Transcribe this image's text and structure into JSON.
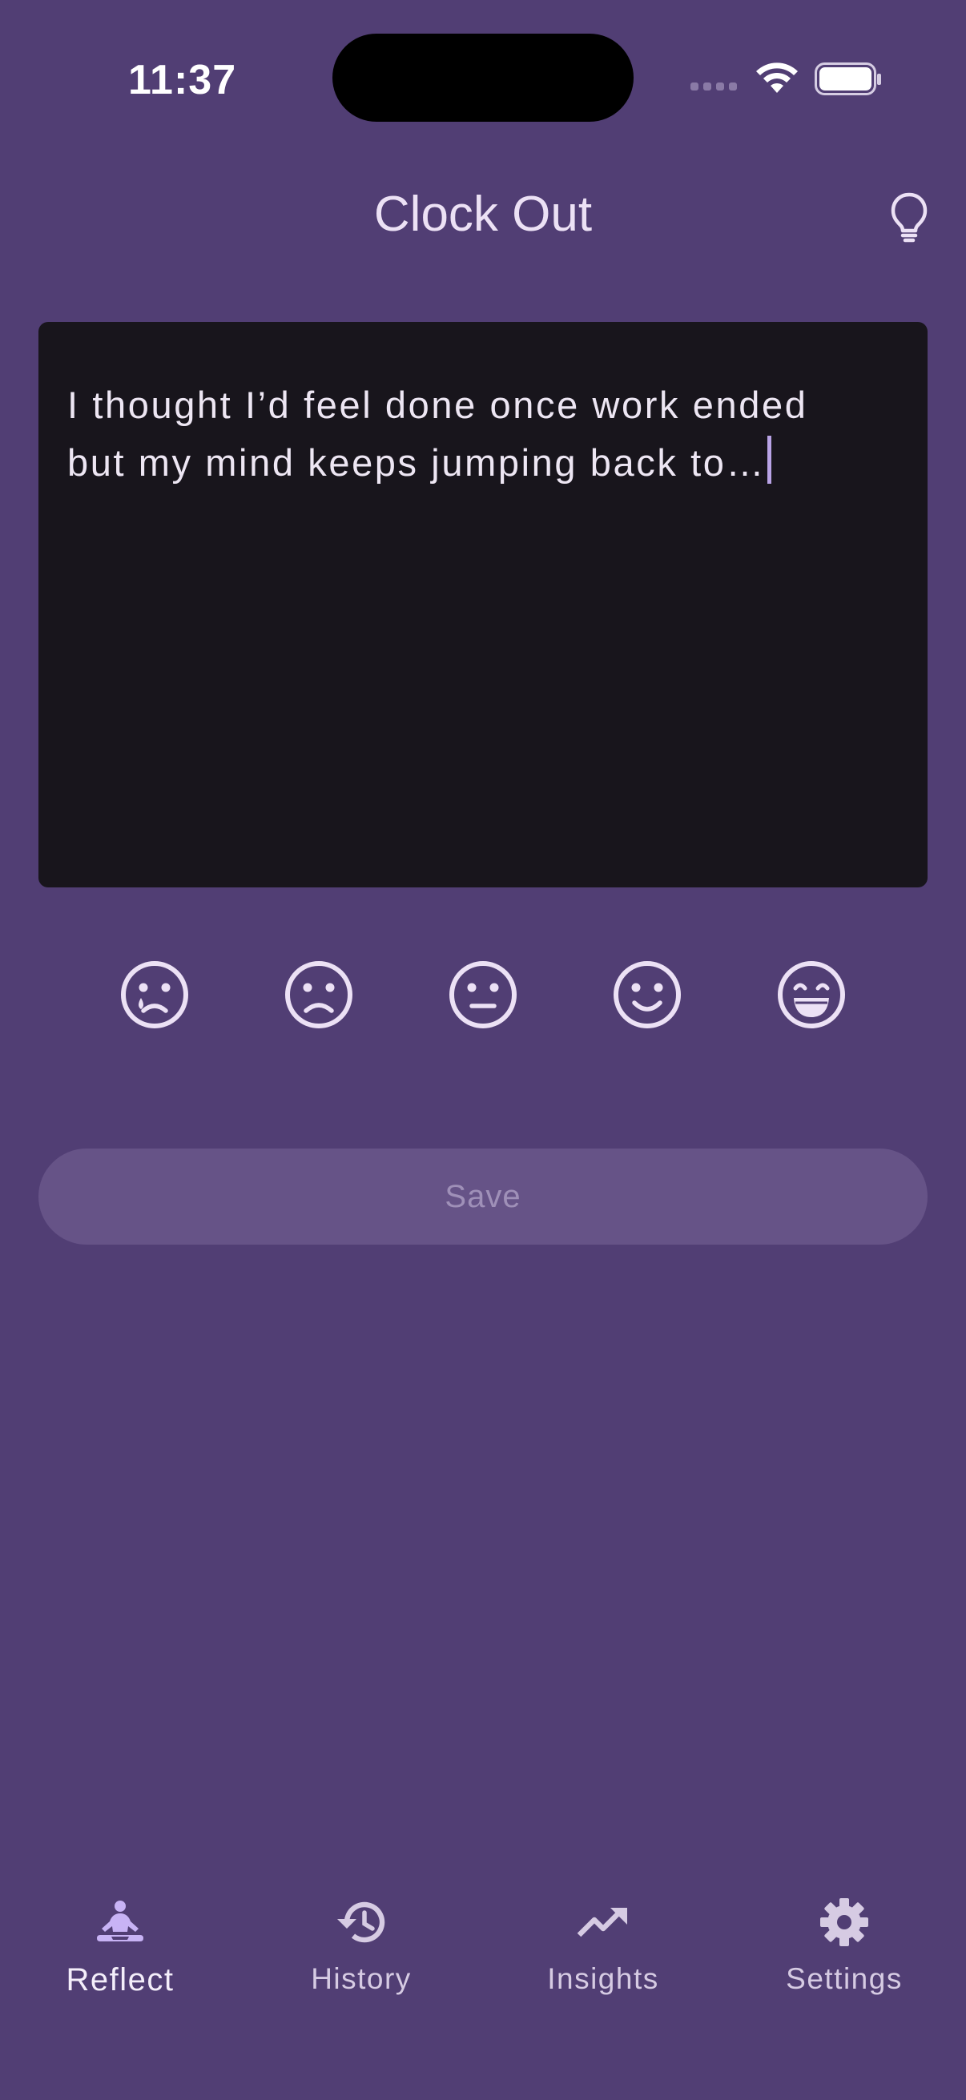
{
  "status_bar": {
    "time": "11:37"
  },
  "header": {
    "title": "Clock Out",
    "action_icon": "lightbulb-icon"
  },
  "journal": {
    "text": "I thought I’d feel done once work ended\nbut my mind keeps jumping back to…"
  },
  "moods": [
    {
      "icon": "very-sad-face-icon"
    },
    {
      "icon": "sad-face-icon"
    },
    {
      "icon": "neutral-face-icon"
    },
    {
      "icon": "happy-face-icon"
    },
    {
      "icon": "very-happy-face-icon"
    }
  ],
  "save_button": {
    "label": "Save"
  },
  "bottom_nav": {
    "items": [
      {
        "label": "Reflect",
        "icon": "meditation-icon",
        "active": true
      },
      {
        "label": "History",
        "icon": "history-icon",
        "active": false
      },
      {
        "label": "Insights",
        "icon": "trending-up-icon",
        "active": false
      },
      {
        "label": "Settings",
        "icon": "gear-icon",
        "active": false
      }
    ]
  },
  "colors": {
    "background": "#513e74",
    "card": "#18151c",
    "accent": "#c8b3f5",
    "save_button": "#665387"
  }
}
